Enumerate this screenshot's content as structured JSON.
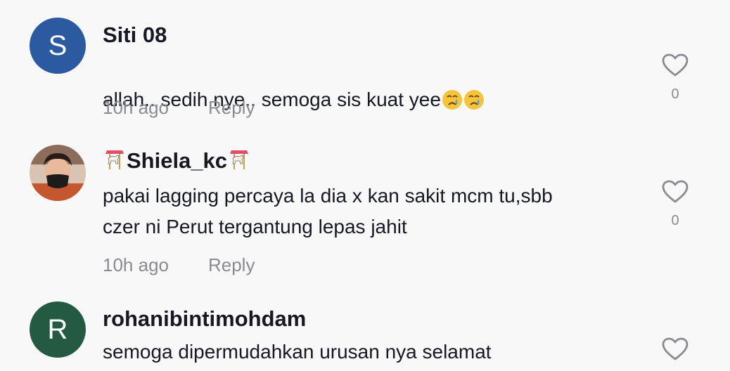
{
  "comments": [
    {
      "username": "Siti 08",
      "avatar_letter": "S",
      "avatar_color": "#2c5aa0",
      "text": "allah.. sedih nye.. semoga sis kuat yee",
      "text_emojis": [
        "crying-face",
        "crying-face"
      ],
      "time": "10h ago",
      "reply_label": "Reply",
      "likes": "0"
    },
    {
      "username": "Shiela_kc",
      "username_emoji": "carousel-horse",
      "avatar_type": "photo",
      "text": "pakai lagging percaya la dia x kan sakit mcm tu,sbb\nczer ni Perut tergantung lepas jahit",
      "time": "10h ago",
      "reply_label": "Reply",
      "likes": "0"
    },
    {
      "username": "rohanibintimohdam",
      "avatar_letter": "R",
      "avatar_color": "#235a41",
      "text": "semoga dipermudahkan urusan nya selamat"
    }
  ],
  "colors": {
    "background": "#f8f8f8",
    "primary_text": "#161823",
    "secondary_text": "#8a8b91",
    "heart_outline": "#8a8b91"
  }
}
